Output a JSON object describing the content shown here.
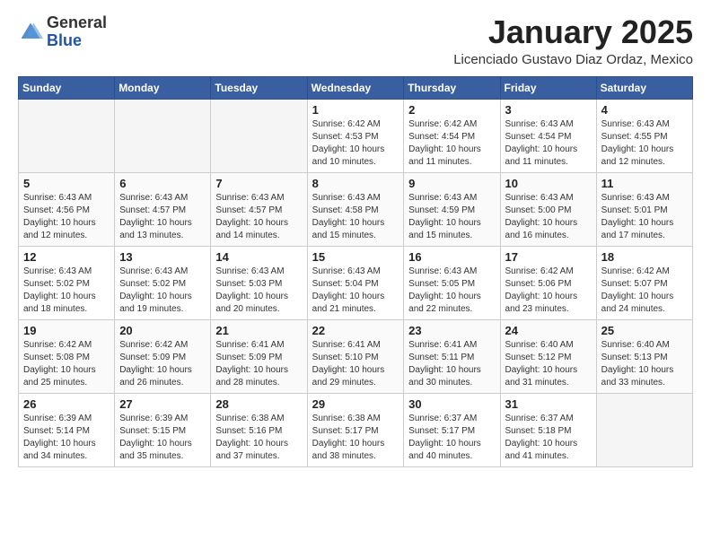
{
  "header": {
    "logo_general": "General",
    "logo_blue": "Blue",
    "month_title": "January 2025",
    "location": "Licenciado Gustavo Diaz Ordaz, Mexico"
  },
  "weekdays": [
    "Sunday",
    "Monday",
    "Tuesday",
    "Wednesday",
    "Thursday",
    "Friday",
    "Saturday"
  ],
  "weeks": [
    [
      {
        "day": "",
        "sunrise": "",
        "sunset": "",
        "daylight": ""
      },
      {
        "day": "",
        "sunrise": "",
        "sunset": "",
        "daylight": ""
      },
      {
        "day": "",
        "sunrise": "",
        "sunset": "",
        "daylight": ""
      },
      {
        "day": "1",
        "sunrise": "Sunrise: 6:42 AM",
        "sunset": "Sunset: 4:53 PM",
        "daylight": "Daylight: 10 hours and 10 minutes."
      },
      {
        "day": "2",
        "sunrise": "Sunrise: 6:42 AM",
        "sunset": "Sunset: 4:54 PM",
        "daylight": "Daylight: 10 hours and 11 minutes."
      },
      {
        "day": "3",
        "sunrise": "Sunrise: 6:43 AM",
        "sunset": "Sunset: 4:54 PM",
        "daylight": "Daylight: 10 hours and 11 minutes."
      },
      {
        "day": "4",
        "sunrise": "Sunrise: 6:43 AM",
        "sunset": "Sunset: 4:55 PM",
        "daylight": "Daylight: 10 hours and 12 minutes."
      }
    ],
    [
      {
        "day": "5",
        "sunrise": "Sunrise: 6:43 AM",
        "sunset": "Sunset: 4:56 PM",
        "daylight": "Daylight: 10 hours and 12 minutes."
      },
      {
        "day": "6",
        "sunrise": "Sunrise: 6:43 AM",
        "sunset": "Sunset: 4:57 PM",
        "daylight": "Daylight: 10 hours and 13 minutes."
      },
      {
        "day": "7",
        "sunrise": "Sunrise: 6:43 AM",
        "sunset": "Sunset: 4:57 PM",
        "daylight": "Daylight: 10 hours and 14 minutes."
      },
      {
        "day": "8",
        "sunrise": "Sunrise: 6:43 AM",
        "sunset": "Sunset: 4:58 PM",
        "daylight": "Daylight: 10 hours and 15 minutes."
      },
      {
        "day": "9",
        "sunrise": "Sunrise: 6:43 AM",
        "sunset": "Sunset: 4:59 PM",
        "daylight": "Daylight: 10 hours and 15 minutes."
      },
      {
        "day": "10",
        "sunrise": "Sunrise: 6:43 AM",
        "sunset": "Sunset: 5:00 PM",
        "daylight": "Daylight: 10 hours and 16 minutes."
      },
      {
        "day": "11",
        "sunrise": "Sunrise: 6:43 AM",
        "sunset": "Sunset: 5:01 PM",
        "daylight": "Daylight: 10 hours and 17 minutes."
      }
    ],
    [
      {
        "day": "12",
        "sunrise": "Sunrise: 6:43 AM",
        "sunset": "Sunset: 5:02 PM",
        "daylight": "Daylight: 10 hours and 18 minutes."
      },
      {
        "day": "13",
        "sunrise": "Sunrise: 6:43 AM",
        "sunset": "Sunset: 5:02 PM",
        "daylight": "Daylight: 10 hours and 19 minutes."
      },
      {
        "day": "14",
        "sunrise": "Sunrise: 6:43 AM",
        "sunset": "Sunset: 5:03 PM",
        "daylight": "Daylight: 10 hours and 20 minutes."
      },
      {
        "day": "15",
        "sunrise": "Sunrise: 6:43 AM",
        "sunset": "Sunset: 5:04 PM",
        "daylight": "Daylight: 10 hours and 21 minutes."
      },
      {
        "day": "16",
        "sunrise": "Sunrise: 6:43 AM",
        "sunset": "Sunset: 5:05 PM",
        "daylight": "Daylight: 10 hours and 22 minutes."
      },
      {
        "day": "17",
        "sunrise": "Sunrise: 6:42 AM",
        "sunset": "Sunset: 5:06 PM",
        "daylight": "Daylight: 10 hours and 23 minutes."
      },
      {
        "day": "18",
        "sunrise": "Sunrise: 6:42 AM",
        "sunset": "Sunset: 5:07 PM",
        "daylight": "Daylight: 10 hours and 24 minutes."
      }
    ],
    [
      {
        "day": "19",
        "sunrise": "Sunrise: 6:42 AM",
        "sunset": "Sunset: 5:08 PM",
        "daylight": "Daylight: 10 hours and 25 minutes."
      },
      {
        "day": "20",
        "sunrise": "Sunrise: 6:42 AM",
        "sunset": "Sunset: 5:09 PM",
        "daylight": "Daylight: 10 hours and 26 minutes."
      },
      {
        "day": "21",
        "sunrise": "Sunrise: 6:41 AM",
        "sunset": "Sunset: 5:09 PM",
        "daylight": "Daylight: 10 hours and 28 minutes."
      },
      {
        "day": "22",
        "sunrise": "Sunrise: 6:41 AM",
        "sunset": "Sunset: 5:10 PM",
        "daylight": "Daylight: 10 hours and 29 minutes."
      },
      {
        "day": "23",
        "sunrise": "Sunrise: 6:41 AM",
        "sunset": "Sunset: 5:11 PM",
        "daylight": "Daylight: 10 hours and 30 minutes."
      },
      {
        "day": "24",
        "sunrise": "Sunrise: 6:40 AM",
        "sunset": "Sunset: 5:12 PM",
        "daylight": "Daylight: 10 hours and 31 minutes."
      },
      {
        "day": "25",
        "sunrise": "Sunrise: 6:40 AM",
        "sunset": "Sunset: 5:13 PM",
        "daylight": "Daylight: 10 hours and 33 minutes."
      }
    ],
    [
      {
        "day": "26",
        "sunrise": "Sunrise: 6:39 AM",
        "sunset": "Sunset: 5:14 PM",
        "daylight": "Daylight: 10 hours and 34 minutes."
      },
      {
        "day": "27",
        "sunrise": "Sunrise: 6:39 AM",
        "sunset": "Sunset: 5:15 PM",
        "daylight": "Daylight: 10 hours and 35 minutes."
      },
      {
        "day": "28",
        "sunrise": "Sunrise: 6:38 AM",
        "sunset": "Sunset: 5:16 PM",
        "daylight": "Daylight: 10 hours and 37 minutes."
      },
      {
        "day": "29",
        "sunrise": "Sunrise: 6:38 AM",
        "sunset": "Sunset: 5:17 PM",
        "daylight": "Daylight: 10 hours and 38 minutes."
      },
      {
        "day": "30",
        "sunrise": "Sunrise: 6:37 AM",
        "sunset": "Sunset: 5:17 PM",
        "daylight": "Daylight: 10 hours and 40 minutes."
      },
      {
        "day": "31",
        "sunrise": "Sunrise: 6:37 AM",
        "sunset": "Sunset: 5:18 PM",
        "daylight": "Daylight: 10 hours and 41 minutes."
      },
      {
        "day": "",
        "sunrise": "",
        "sunset": "",
        "daylight": ""
      }
    ]
  ]
}
